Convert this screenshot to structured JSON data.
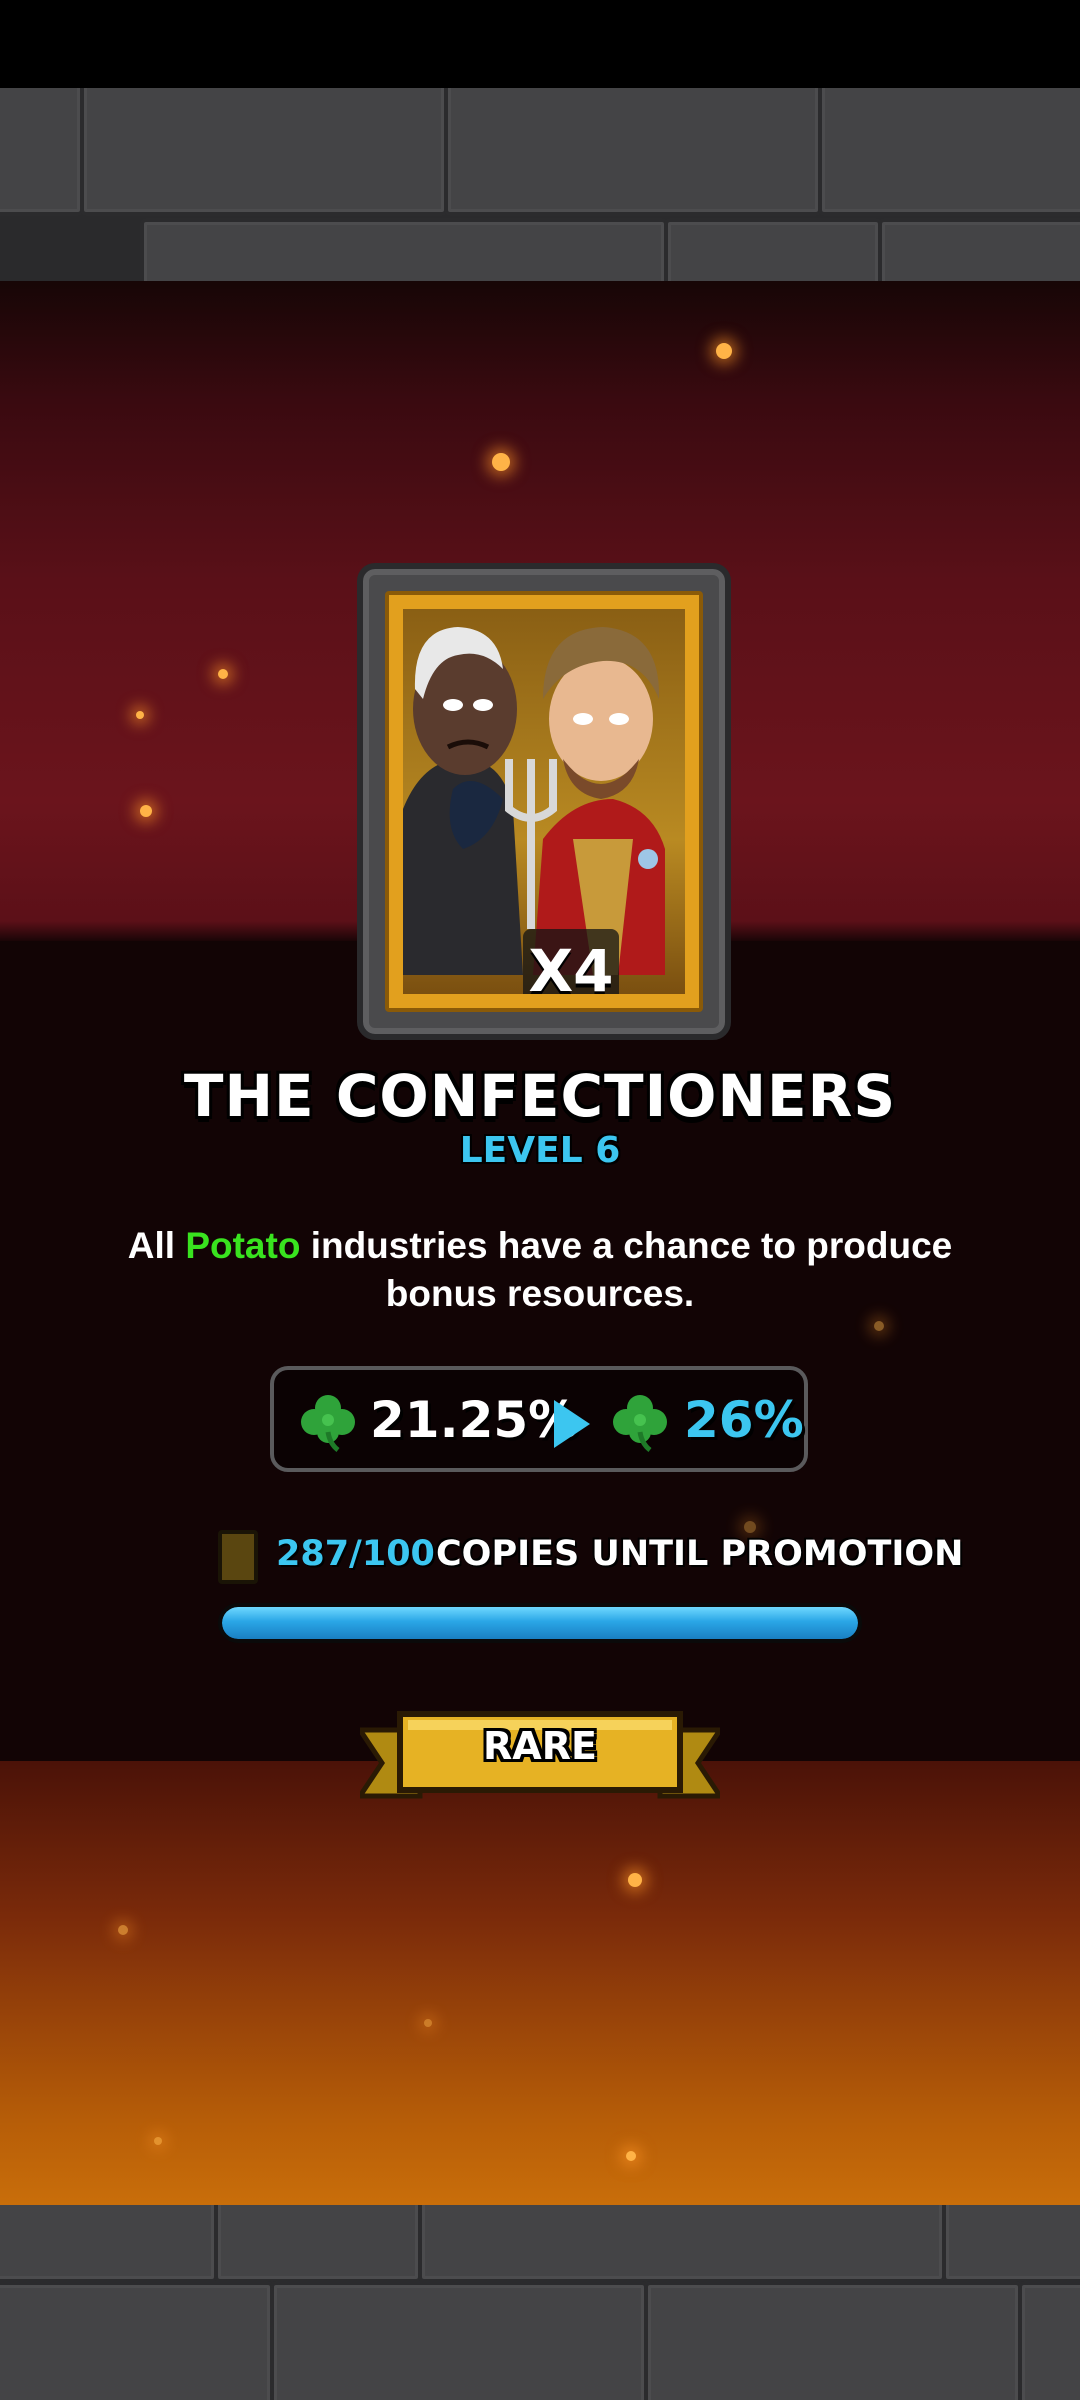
{
  "card": {
    "name": "THE CONFECTIONERS",
    "level": "LEVEL 6",
    "multiplier": "X4",
    "rarity": "RARE"
  },
  "description": {
    "prefix": "All ",
    "highlight": "Potato",
    "suffix": " industries have a chance to produce bonus resources."
  },
  "stats": {
    "current": "21.25%",
    "next": "26%",
    "icon": "clover-icon"
  },
  "copies": {
    "count": "287/100",
    "label": "COPIES UNTIL PROMOTION",
    "progress_fraction": 1.0
  },
  "colors": {
    "accent_blue": "#3cc6f0",
    "highlight_green": "#39e31f",
    "gold": "#e2a01e"
  }
}
